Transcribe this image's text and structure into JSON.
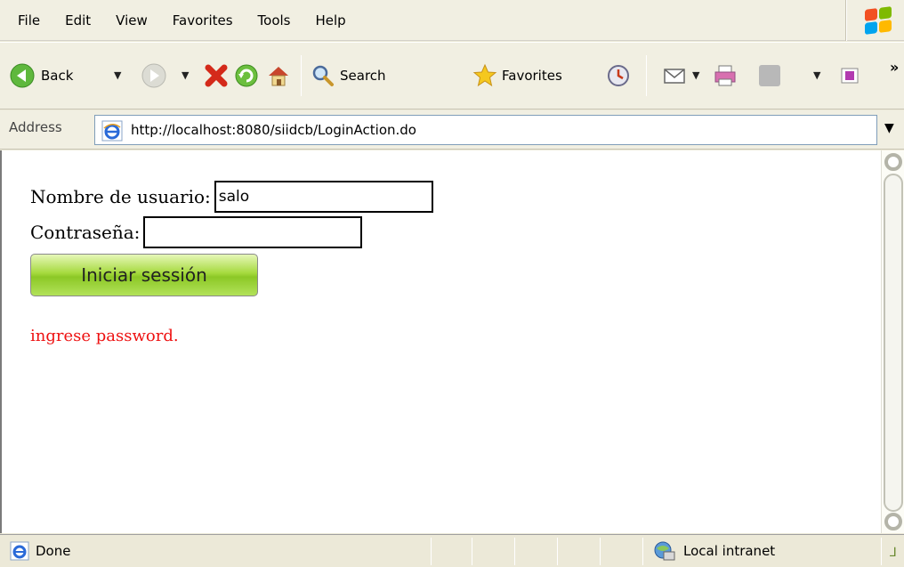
{
  "menu": [
    "File",
    "Edit",
    "View",
    "Favorites",
    "Tools",
    "Help"
  ],
  "toolbar": {
    "back_label": "Back",
    "search_label": "Search",
    "favorites_label": "Favorites",
    "overflow": "»"
  },
  "address": {
    "label": "Address",
    "url": "http://localhost:8080/siidcb/LoginAction.do"
  },
  "form": {
    "username_label": "Nombre de usuario:",
    "username_value": "salo",
    "password_label": "Contraseña:",
    "password_value": "",
    "submit_label": "Iniciar sessión",
    "error_message": "ingrese password."
  },
  "status": {
    "text": "Done",
    "zone": "Local intranet"
  },
  "colors": {
    "error": "#ee1111",
    "button_green": "#a6da3e",
    "chrome": "#ece9d8"
  },
  "icons": [
    "back-arrow-icon",
    "forward-arrow-icon",
    "stop-icon",
    "refresh-icon",
    "home-icon",
    "search-icon",
    "favorites-star-icon",
    "history-icon",
    "mail-icon",
    "print-icon",
    "edit-icon",
    "messenger-icon",
    "ie-page-icon",
    "local-intranet-icon",
    "windows-logo-icon"
  ]
}
